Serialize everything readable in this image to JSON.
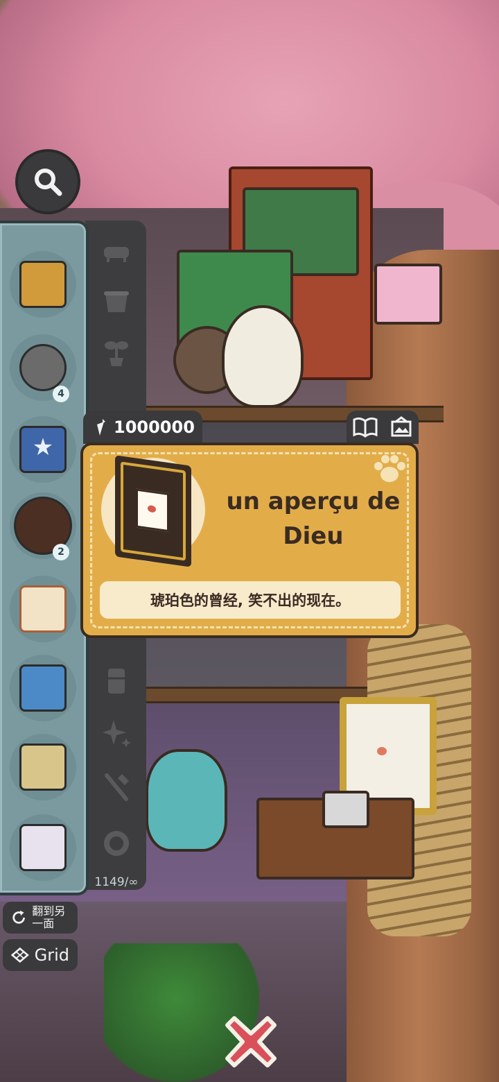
{
  "search": {
    "icon": "search-icon"
  },
  "inventory": {
    "items": [
      {
        "name": "macrame-wall-hanging",
        "badge": ""
      },
      {
        "name": "crystal-spider-lamp",
        "badge": "4"
      },
      {
        "name": "starfish-frame",
        "badge": ""
      },
      {
        "name": "round-shelf",
        "badge": "2"
      },
      {
        "name": "bunny-portrait",
        "badge": ""
      },
      {
        "name": "towel-rack",
        "badge": ""
      },
      {
        "name": "scroll-rack",
        "badge": ""
      },
      {
        "name": "crown-towel-hanger",
        "badge": ""
      }
    ],
    "categories": [
      "bathtub-icon",
      "pot-icon",
      "plant-icon",
      "fridge-icon",
      "sparkle-icon",
      "tools-icon",
      "ring-icon"
    ],
    "counter": "1149/∞"
  },
  "price": {
    "value": "1000000",
    "icon": "carrot-icon"
  },
  "actions": {
    "book_icon": "book-icon",
    "photo_icon": "photo-icon"
  },
  "card": {
    "title": "un aperçu de Dieu",
    "description": "琥珀色的曾经, 笑不出的现在。",
    "deco_icon": "paw-icon"
  },
  "buttons": {
    "flip_label": "翻到另一面",
    "grid_label": "Grid",
    "close_icon": "close-icon"
  },
  "colors": {
    "card_bg": "#e2ad49",
    "panel_bg": "#7a9aa0",
    "dark_ui": "#3a3a3c",
    "close_red": "#d9505a"
  }
}
